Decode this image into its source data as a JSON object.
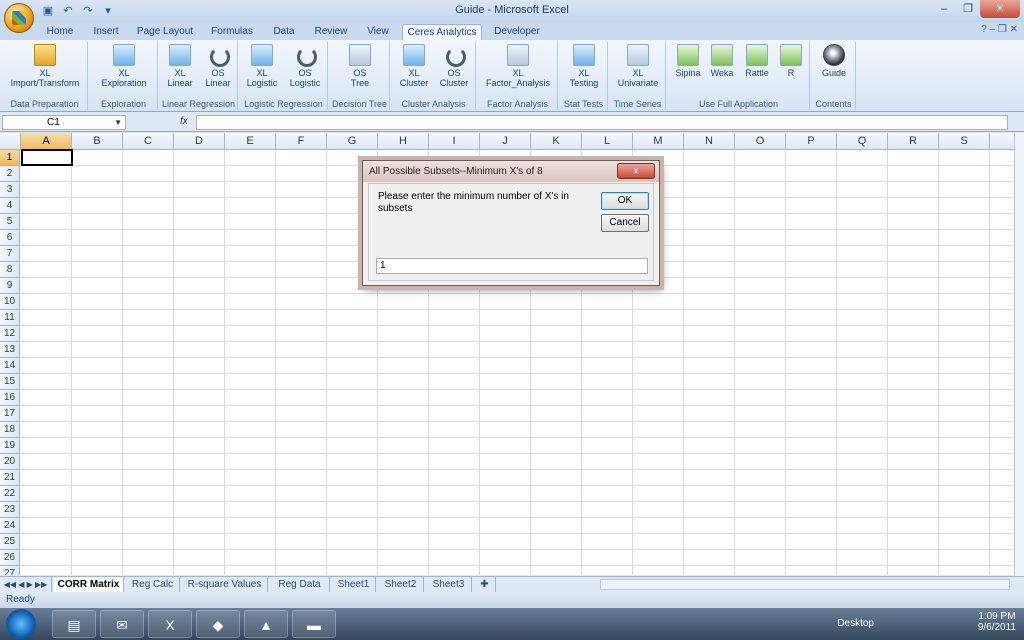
{
  "window": {
    "title": "Guide - Microsoft Excel"
  },
  "ribbon_tabs": [
    "Home",
    "Insert",
    "Page Layout",
    "Formulas",
    "Data",
    "Review",
    "View",
    "Ceres Analytics",
    "Developer"
  ],
  "ribbon": {
    "groups": [
      {
        "label": "Data Preparation",
        "buttons": [
          {
            "line1": "XL",
            "line2": "Import/Transform",
            "icon": "folder-arrow-icon"
          }
        ]
      },
      {
        "label": "Exploration",
        "buttons": [
          {
            "line1": "XL",
            "line2": "Exploration",
            "icon": "exploration-icon"
          }
        ]
      },
      {
        "label": "Linear Regression",
        "buttons": [
          {
            "line1": "XL",
            "line2": "Linear",
            "icon": "linear-chart-icon"
          },
          {
            "line1": "OS",
            "line2": "Linear",
            "icon": "refresh-icon"
          }
        ]
      },
      {
        "label": "Logistic Regression",
        "buttons": [
          {
            "line1": "XL",
            "line2": "Logistic",
            "icon": "logistic-chart-icon"
          },
          {
            "line1": "OS",
            "line2": "Logistic",
            "icon": "refresh-icon"
          }
        ]
      },
      {
        "label": "Decision Tree",
        "buttons": [
          {
            "line1": "OS",
            "line2": "Tree",
            "icon": "tree-icon"
          }
        ]
      },
      {
        "label": "Cluster Analysis",
        "buttons": [
          {
            "line1": "XL",
            "line2": "Cluster",
            "icon": "cluster-icon"
          },
          {
            "line1": "OS",
            "line2": "Cluster",
            "icon": "refresh-icon"
          }
        ]
      },
      {
        "label": "Factor Analysis",
        "buttons": [
          {
            "line1": "XL",
            "line2": "Factor_Analysis",
            "icon": "factor-icon"
          }
        ]
      },
      {
        "label": "Stat Tests",
        "buttons": [
          {
            "line1": "XL",
            "line2": "Testing",
            "icon": "testing-icon"
          }
        ]
      },
      {
        "label": "Time Series",
        "buttons": [
          {
            "line1": "XL",
            "line2": "Univariate",
            "icon": "univariate-icon"
          }
        ]
      },
      {
        "label": "Use Full Application",
        "buttons": [
          {
            "line1": "Sipina",
            "line2": "",
            "icon": "sipina-icon"
          },
          {
            "line1": "Weka",
            "line2": "",
            "icon": "weka-icon"
          },
          {
            "line1": "Rattle",
            "line2": "",
            "icon": "rattle-icon"
          },
          {
            "line1": "R",
            "line2": "",
            "icon": "r-icon"
          }
        ]
      },
      {
        "label": "Contents",
        "buttons": [
          {
            "line1": "Guide",
            "line2": "",
            "icon": "guide-icon"
          }
        ]
      }
    ]
  },
  "formula_bar": {
    "name_box": "C1",
    "fx": "fx",
    "value": ""
  },
  "columns": [
    "A",
    "B",
    "C",
    "D",
    "E",
    "F",
    "G",
    "H",
    "I",
    "J",
    "K",
    "L",
    "M",
    "N",
    "O",
    "P",
    "Q",
    "R",
    "S"
  ],
  "rows": [
    "1",
    "2",
    "3",
    "4",
    "5",
    "6",
    "7",
    "8",
    "9",
    "10",
    "11",
    "12",
    "13",
    "14",
    "15",
    "16",
    "17",
    "18",
    "19",
    "20",
    "21",
    "22",
    "23",
    "24",
    "25",
    "26",
    "27"
  ],
  "sheet_tabs": [
    "CORR Matrix",
    "Reg Calc",
    "R-square Values",
    "Reg Data",
    "Sheet1",
    "Sheet2",
    "Sheet3"
  ],
  "status": {
    "text": "Ready"
  },
  "dialog": {
    "title": "All Possible Subsets--Minimum X's of 8",
    "close": "x",
    "message": "Please enter the minimum number of X's in subsets",
    "ok": "OK",
    "cancel": "Cancel",
    "input_value": "1"
  },
  "taskbar": {
    "desktop": "Desktop",
    "time": "1:09 PM",
    "date": "9/6/2011"
  }
}
